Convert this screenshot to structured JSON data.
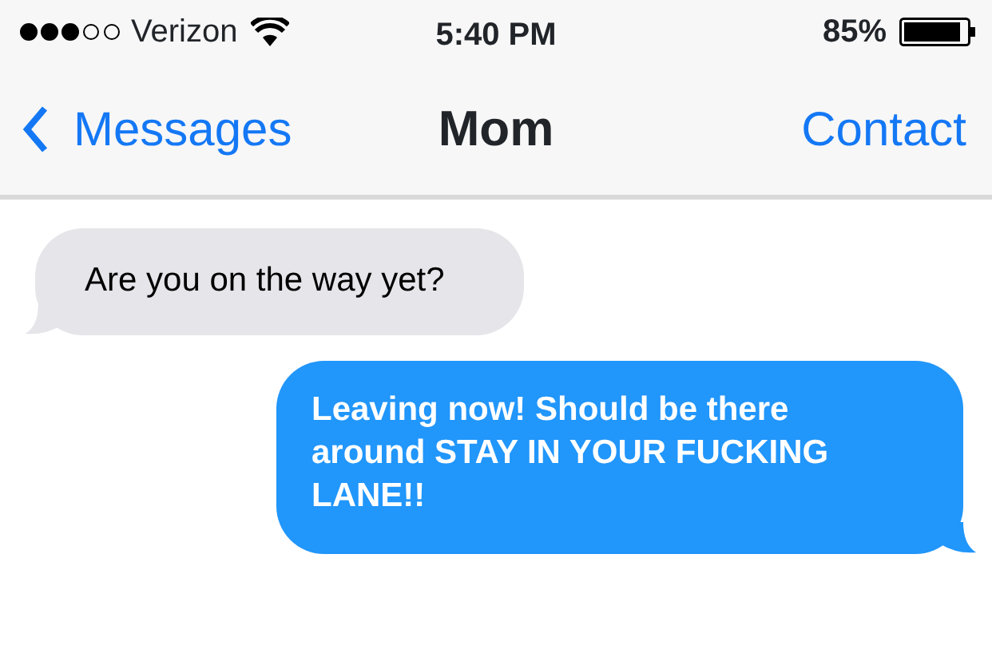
{
  "status_bar": {
    "carrier": "Verizon",
    "time": "5:40 PM",
    "battery": "85%"
  },
  "nav_bar": {
    "back": "Messages",
    "title": "Mom",
    "action": "Contact"
  },
  "messages": [
    {
      "kind": "incoming",
      "text": "Are you on the way yet?"
    },
    {
      "kind": "outgoing",
      "text": "Leaving now! Should be there around STAY IN YOUR FUCKING LANE!!"
    }
  ]
}
